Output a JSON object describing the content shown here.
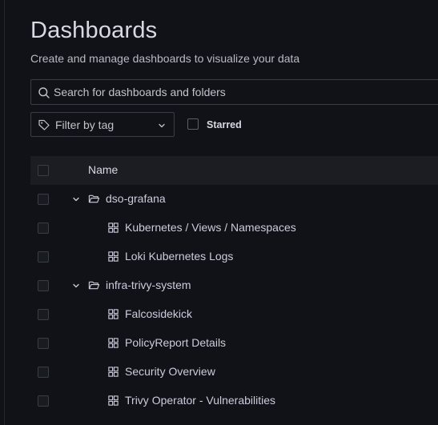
{
  "page": {
    "title": "Dashboards",
    "subtitle": "Create and manage dashboards to visualize your data"
  },
  "search": {
    "placeholder": "Search for dashboards and folders",
    "icon": "search-icon"
  },
  "filters": {
    "tag_placeholder": "Filter by tag",
    "starred_label": "Starred",
    "starred_checked": false
  },
  "table": {
    "header_name": "Name",
    "folders": [
      {
        "name": "dso-grafana",
        "expanded": true,
        "dashboards": [
          {
            "name": "Kubernetes / Views / Namespaces"
          },
          {
            "name": "Loki Kubernetes Logs"
          }
        ]
      },
      {
        "name": "infra-trivy-system",
        "expanded": true,
        "dashboards": [
          {
            "name": "Falcosidekick"
          },
          {
            "name": "PolicyReport Details"
          },
          {
            "name": "Security Overview"
          },
          {
            "name": "Trivy Operator - Vulnerabilities"
          }
        ]
      }
    ]
  },
  "colors": {
    "background": "#111217",
    "header_row": "#1c1d23",
    "border": "#3a3d45",
    "text": "#ccccdc"
  }
}
